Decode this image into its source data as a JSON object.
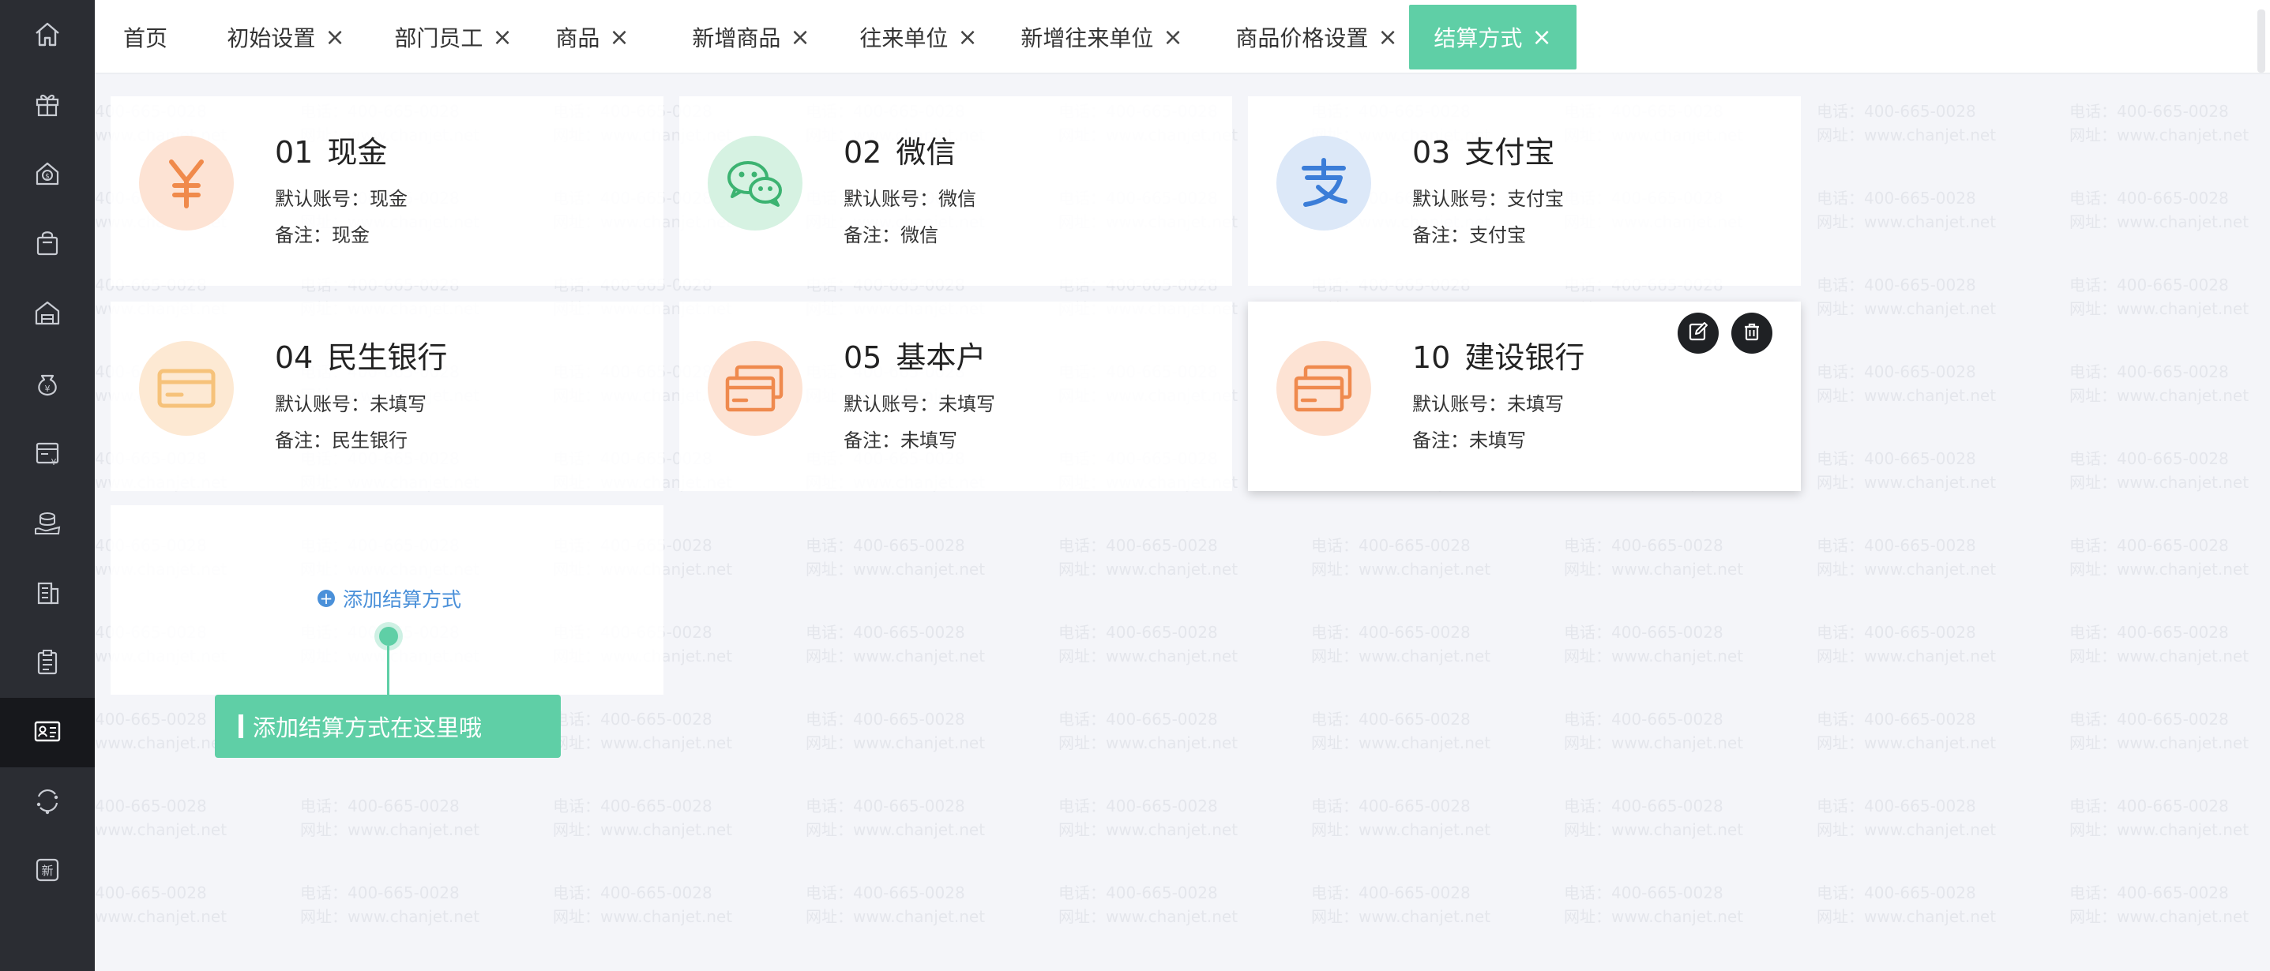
{
  "sidebar": {
    "items": [
      {
        "icon": "home-icon"
      },
      {
        "icon": "gift-icon"
      },
      {
        "icon": "money-bag-icon"
      },
      {
        "icon": "shopping-bag-icon"
      },
      {
        "icon": "warehouse-icon"
      },
      {
        "icon": "yuan-pouch-icon"
      },
      {
        "icon": "invoice-icon"
      },
      {
        "icon": "coin-hand-icon"
      },
      {
        "icon": "building-icon"
      },
      {
        "icon": "clipboard-icon"
      },
      {
        "icon": "id-card-icon",
        "active": true
      },
      {
        "icon": "refresh-circle-icon"
      },
      {
        "icon": "new-badge-icon",
        "text": "新"
      }
    ]
  },
  "tabs": [
    {
      "label": "首页",
      "closable": false
    },
    {
      "label": "初始设置",
      "closable": true
    },
    {
      "label": "部门员工",
      "closable": true
    },
    {
      "label": "商品",
      "closable": true
    },
    {
      "label": "新增商品",
      "closable": true
    },
    {
      "label": "往来单位",
      "closable": true
    },
    {
      "label": "新增往来单位",
      "closable": true
    },
    {
      "label": "商品价格设置",
      "closable": true
    },
    {
      "label": "结算方式",
      "closable": true,
      "active": true
    }
  ],
  "tab_close_glyph": "×",
  "watermark": {
    "phone": "电话：400-665-0028",
    "site": "网址：www.chanjet.net"
  },
  "labels": {
    "account_prefix": "默认账号：",
    "remark_prefix": "备注："
  },
  "cards": [
    {
      "code": "01",
      "name": "现金",
      "account": "现金",
      "remark": "现金",
      "icon": "yuan-icon",
      "icon_color": "#f08a4b",
      "icon_bg": "#fde3d4"
    },
    {
      "code": "02",
      "name": "微信",
      "account": "微信",
      "remark": "微信",
      "icon": "wechat-icon",
      "icon_color": "#3cb371",
      "icon_bg": "#d6f2e2"
    },
    {
      "code": "03",
      "name": "支付宝",
      "account": "支付宝",
      "remark": "支付宝",
      "icon": "alipay-icon",
      "icon_color": "#3b7dd8",
      "icon_bg": "#dce8f8"
    },
    {
      "code": "04",
      "name": "民生银行",
      "account": "未填写",
      "remark": "民生银行",
      "icon": "bank-card-icon",
      "icon_color": "#f6c27a",
      "icon_bg": "#fde9d3"
    },
    {
      "code": "05",
      "name": "基本户",
      "account": "未填写",
      "remark": "未填写",
      "icon": "bank-cards-icon",
      "icon_color": "#ef8a4e",
      "icon_bg": "#fde3d4"
    },
    {
      "code": "10",
      "name": "建设银行",
      "account": "未填写",
      "remark": "未填写",
      "icon": "bank-cards-icon",
      "icon_color": "#ef8a4e",
      "icon_bg": "#fde3d4",
      "hovered": true
    }
  ],
  "add_card": {
    "label": "添加结算方式"
  },
  "guide": {
    "tip": "添加结算方式在这里哦"
  },
  "colors": {
    "accent": "#5fcfa6",
    "link": "#4a90d9",
    "sidebar_bg": "#2b2d33",
    "sidebar_active": "#17181c"
  }
}
